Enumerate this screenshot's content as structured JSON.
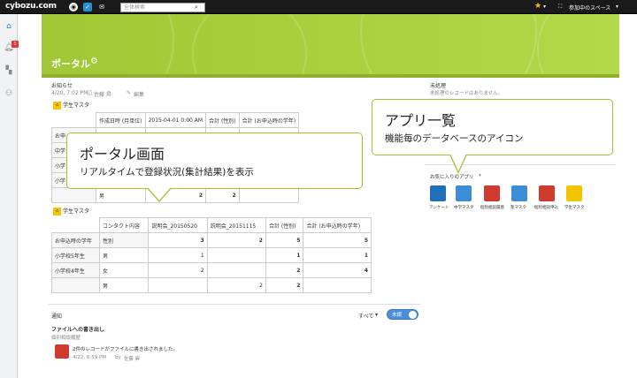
{
  "topbar": {
    "logo": "cybozu.com",
    "search_placeholder": "全体検索",
    "user_menu": "参加中のスペース",
    "caret": "▾"
  },
  "sidenav": {
    "notification_count": "1"
  },
  "portal": {
    "title": "ポータル"
  },
  "announcement": {
    "heading": "お知らせ",
    "meta": "4/20, 7:02 PM",
    "author": "佐藤 昇",
    "edit": "編集"
  },
  "app1": {
    "name": "学生マスタ",
    "headers": [
      "作成日時 (月単位)",
      "2015-04-01 0:00 AM",
      "合計 (性別)",
      "合計 (お申込時の学年)"
    ],
    "row_label_partial": "お申",
    "rows": [
      {
        "a": "中学",
        "b": "",
        "c": "",
        "d": ""
      },
      {
        "a": "小学",
        "b": "",
        "c": "",
        "d": ""
      },
      {
        "a": "小学",
        "b": "",
        "c": "",
        "d": ""
      },
      {
        "a": "",
        "b": "男",
        "c": "2",
        "d": "2"
      }
    ]
  },
  "app2": {
    "name": "学生マスタ",
    "headers": [
      "コンタクト内容",
      "説明会_20150520",
      "説明会_20151115",
      "合計 (性別)",
      "合計 (お申込時の学年)"
    ],
    "rows": [
      {
        "grade": "お申込時の学年",
        "gender": "性別",
        "v1": "3",
        "v2": "2",
        "v3": "5",
        "v4": "5"
      },
      {
        "grade": "小学校5年生",
        "gender": "男",
        "v1": "1",
        "v2": "",
        "v3": "1",
        "v4": "1"
      },
      {
        "grade": "小学校4年生",
        "gender": "女",
        "v1": "2",
        "v2": "",
        "v3": "2",
        "v4": "4"
      },
      {
        "grade": "",
        "gender": "男",
        "v1": "",
        "v2": "2",
        "v3": "2",
        "v4": ""
      }
    ]
  },
  "unprocessed": {
    "heading": "未処理",
    "empty": "未処理のレコードはありません。"
  },
  "favorites": {
    "heading": "お気に入りのアプリ",
    "apps": [
      {
        "label": "アンケート",
        "color": "#1e6fb8"
      },
      {
        "label": "中学マスタ",
        "color": "#3b8ed6"
      },
      {
        "label": "個別相談履歴",
        "color": "#d13b2e"
      },
      {
        "label": "塾マスタ",
        "color": "#3b8ed6"
      },
      {
        "label": "個別相談申込",
        "color": "#d13b2e"
      },
      {
        "label": "学生マスタ",
        "color": "#f4c400"
      }
    ]
  },
  "notifications": {
    "heading": "通知",
    "filter": "すべて",
    "toggle_label": "未読",
    "item_title": "ファイルへの書き出し",
    "item_sub": "個別相談履歴",
    "item_msg": "2件のレコードがファイルに書き出されました。",
    "item_time": "4/22, 6:59 PM",
    "item_by": "by",
    "item_author": "佐藤 昇"
  },
  "callouts": {
    "portal_title": "ポータル画面",
    "portal_sub": "リアルタイムで登録状況(集計結果)を表示",
    "apps_title": "アプリ一覧",
    "apps_sub": "機能毎のデータベースのアイコン"
  }
}
